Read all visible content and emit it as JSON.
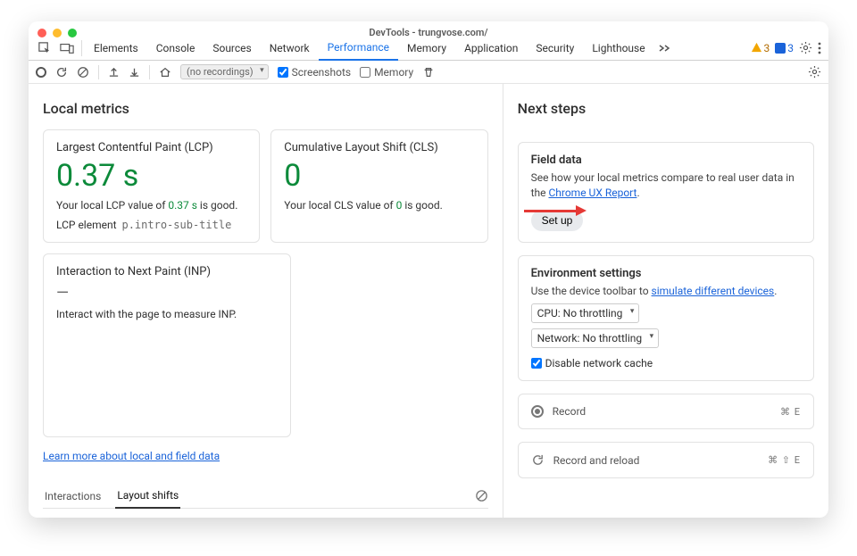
{
  "title": "DevTools - trungvose.com/",
  "tabs": [
    "Elements",
    "Console",
    "Sources",
    "Network",
    "Performance",
    "Memory",
    "Application",
    "Security",
    "Lighthouse"
  ],
  "warnings": "3",
  "issues": "3",
  "toolbar": {
    "recordings_placeholder": "(no recordings)",
    "screenshots_label": "Screenshots",
    "memory_label": "Memory"
  },
  "left": {
    "heading": "Local metrics",
    "lcp": {
      "title": "Largest Contentful Paint (LCP)",
      "value": "0.37 s",
      "desc_prefix": "Your local LCP value of ",
      "desc_val": "0.37 s",
      "desc_suffix": " is good.",
      "elem_label": "LCP element",
      "elem_code": "p.intro-sub-title"
    },
    "cls": {
      "title": "Cumulative Layout Shift (CLS)",
      "value": "0",
      "desc_prefix": "Your local CLS value of ",
      "desc_val": "0",
      "desc_suffix": " is good."
    },
    "inp": {
      "title": "Interaction to Next Paint (INP)",
      "value": "—",
      "desc": "Interact with the page to measure INP."
    },
    "learn": "Learn more about local and field data",
    "subtabs": {
      "a": "Interactions",
      "b": "Layout shifts"
    }
  },
  "right": {
    "heading": "Next steps",
    "field": {
      "title": "Field data",
      "text_a": "See how your local metrics compare to real user data in the ",
      "link": "Chrome UX Report",
      "text_b": ".",
      "button": "Set up"
    },
    "env": {
      "title": "Environment settings",
      "text_a": "Use the device toolbar to ",
      "link": "simulate different devices",
      "text_b": ".",
      "cpu": "CPU: No throttling",
      "net": "Network: No throttling",
      "cache": "Disable network cache"
    },
    "record": {
      "label": "Record",
      "kbd": "⌘ E"
    },
    "reload": {
      "label": "Record and reload",
      "kbd": "⌘ ⇧ E"
    }
  }
}
